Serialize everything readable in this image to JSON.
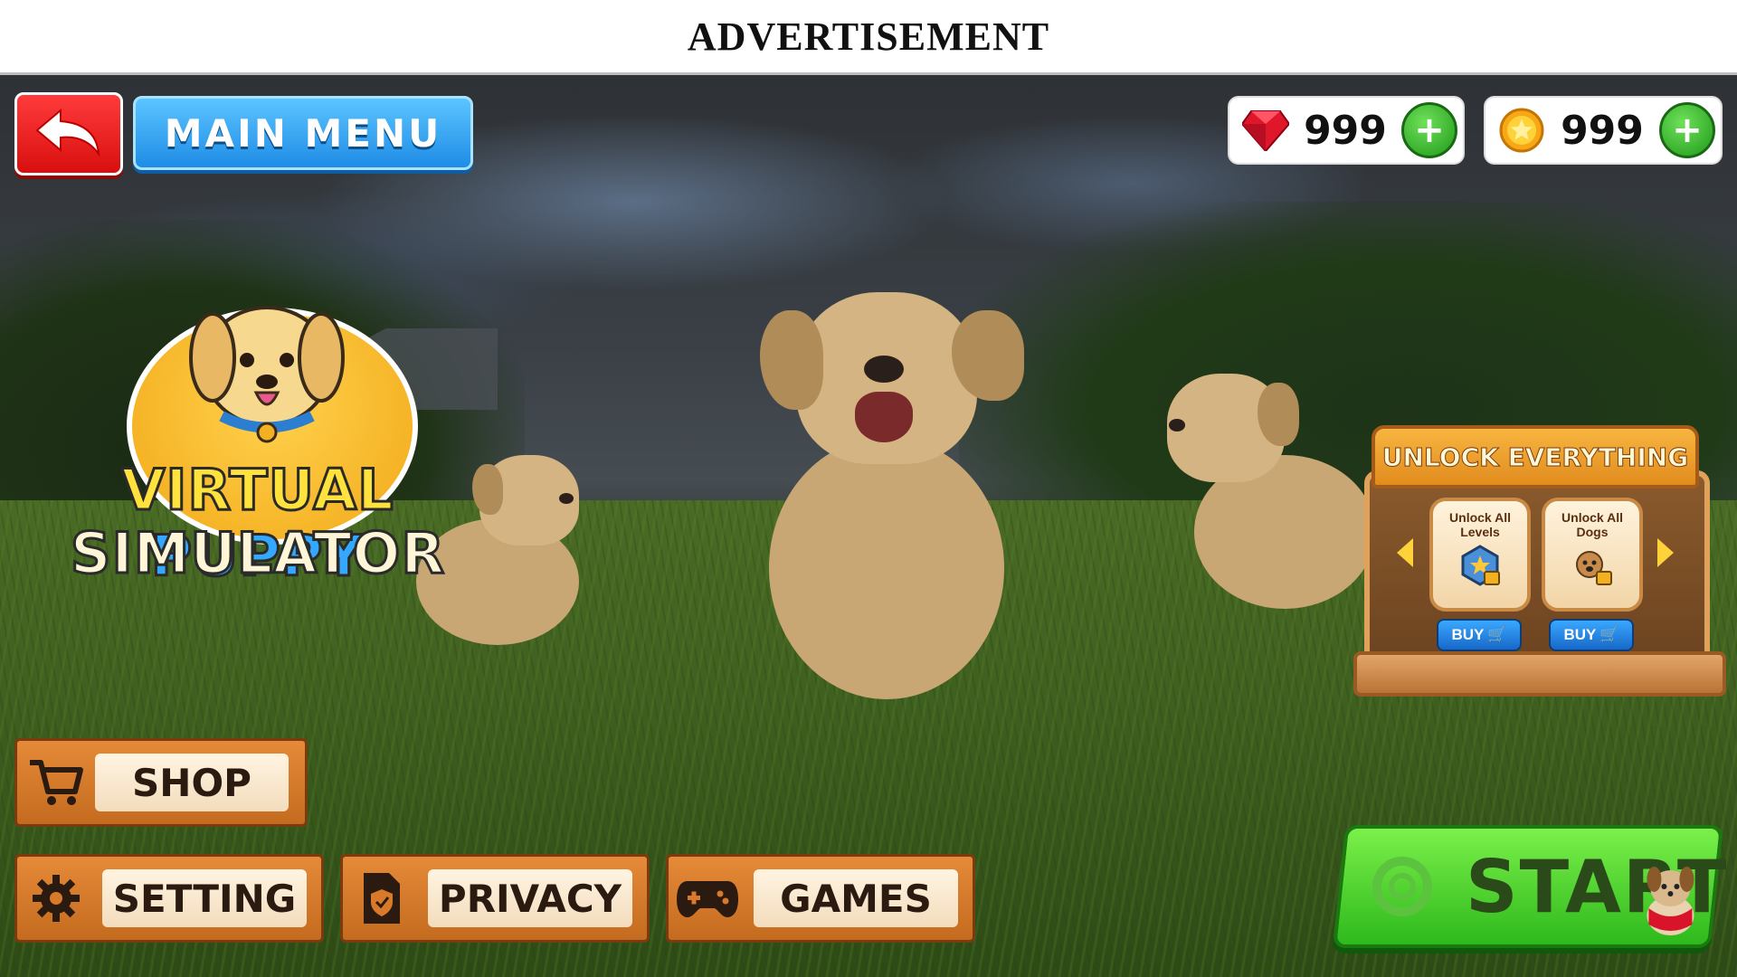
{
  "ad_banner": {
    "text": "ADVERTISEMENT"
  },
  "header": {
    "back_icon": "back-arrow-icon",
    "main_menu_label": "MAIN MENU"
  },
  "currency": {
    "gems": {
      "icon": "gem-icon",
      "value": "999",
      "add_label": "+"
    },
    "coins": {
      "icon": "coin-icon",
      "value": "999",
      "add_label": "+"
    }
  },
  "logo": {
    "word1": "VIRTUAL",
    "word2": "PUPPY",
    "word3": "SIMULATOR"
  },
  "unlock_panel": {
    "title": "UNLOCK EVERYTHING",
    "items": [
      {
        "line1": "Unlock All",
        "line2": "Levels",
        "buy_label": "BUY",
        "icon": "levels-lock-icon"
      },
      {
        "line1": "Unlock All",
        "line2": "Dogs",
        "buy_label": "BUY",
        "icon": "dog-lock-icon"
      }
    ]
  },
  "menu": {
    "shop": {
      "label": "SHOP",
      "icon": "cart-icon"
    },
    "setting": {
      "label": "SETTING",
      "icon": "gear-icon"
    },
    "privacy": {
      "label": "PRIVACY",
      "icon": "shield-document-icon"
    },
    "games": {
      "label": "GAMES",
      "icon": "gamepad-icon"
    }
  },
  "start": {
    "label": "START",
    "icon": "start-ring-icon"
  },
  "colors": {
    "start_green": "#4cd42f",
    "menu_orange": "#d97a2b",
    "main_menu_blue": "#2d9cf0",
    "back_red": "#e51f1f"
  }
}
